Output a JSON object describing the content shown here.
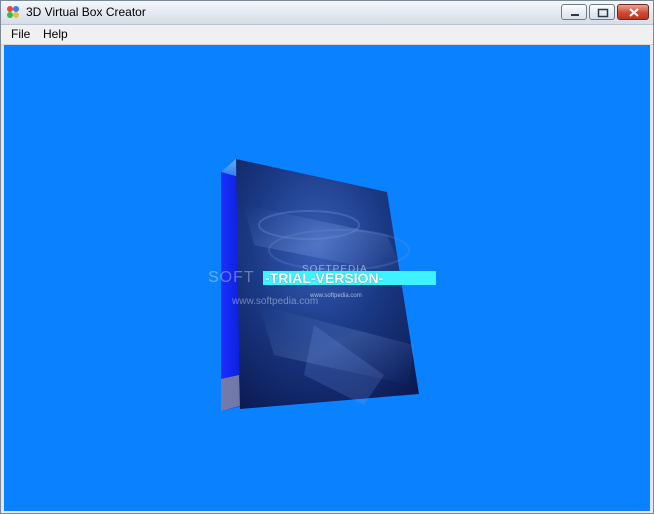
{
  "window": {
    "title": "3D Virtual Box Creator",
    "icon": "app-icon"
  },
  "menu": {
    "items": [
      "File",
      "Help"
    ]
  },
  "viewport": {
    "background_color": "#0a82ff",
    "trial_banner": "-TRIAL-VERSION-",
    "trial_banner_color": "#3ff2ff",
    "box_watermark": "SOFT",
    "box_brand": "SOFTPEDIA",
    "box_url": "www.softpedia.com",
    "box_small_url": "www.softpedia.com"
  }
}
